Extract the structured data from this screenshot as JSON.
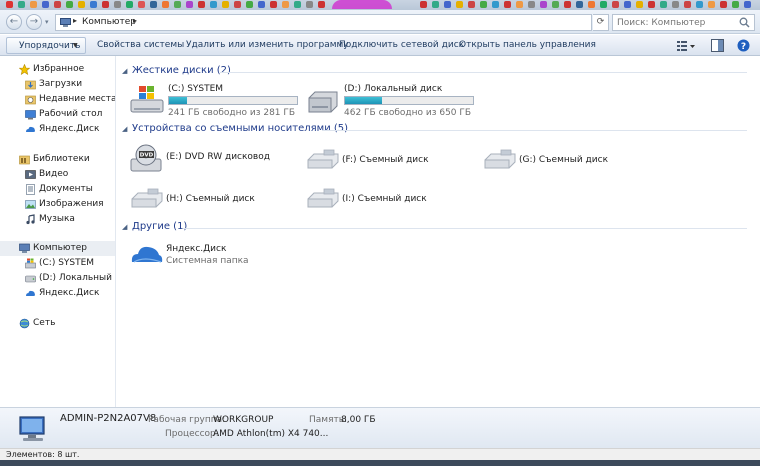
{
  "address_bar": {
    "back": "←",
    "forward": "→",
    "breadcrumb": "Компьютер",
    "refresh": "⟳",
    "search_placeholder": "Поиск: Компьютер"
  },
  "toolbar": {
    "organize": "Упорядочить",
    "system_props": "Свойства системы",
    "uninstall": "Удалить или изменить программу",
    "map_drive": "Подключить сетевой диск",
    "control_panel": "Открыть панель управления"
  },
  "nav": {
    "favorites": "Избранное",
    "downloads": "Загрузки",
    "recent": "Недавние места",
    "desktop": "Рабочий стол",
    "yadisk": "Яндекс.Диск",
    "libraries": "Библиотеки",
    "video": "Видео",
    "documents": "Документы",
    "pictures": "Изображения",
    "music": "Музыка",
    "computer": "Компьютер",
    "c_system": "(C:) SYSTEM",
    "d_local": "(D:) Локальный диск",
    "yadisk2": "Яндекс.Диск",
    "network": "Сеть"
  },
  "groups": {
    "hdd": "Жесткие диски (2)",
    "removable": "Устройства со съемными носителями (5)",
    "other": "Другие (1)"
  },
  "drives": {
    "c": {
      "name": "(C:) SYSTEM",
      "free": "241 ГБ свободно из 281 ГБ",
      "used_fraction": 0.14
    },
    "d": {
      "name": "(D:) Локальный диск",
      "free": "462 ГБ свободно из 650 ГБ",
      "used_fraction": 0.29
    }
  },
  "removable": {
    "e": "(E:) DVD RW дисковод",
    "f": "(F:) Съемный диск",
    "g": "(G:) Съемный диск",
    "h": "(H:) Съемный диск",
    "i": "(I:) Съемный диск"
  },
  "other": {
    "yadisk_name": "Яндекс.Диск",
    "yadisk_sub": "Системная папка"
  },
  "details": {
    "pc_name": "ADMIN-P2N2A07V8",
    "workgroup_key": "Рабочая группа:",
    "workgroup_val": "WORKGROUP",
    "memory_key": "Память:",
    "memory_val": "8,00 ГБ",
    "cpu_key": "Процессор:",
    "cpu_val": "AMD Athlon(tm) X4 740..."
  },
  "status": {
    "items": "Элементов: 8 шт."
  },
  "colors": {
    "accent": "#1e3a8a",
    "bar_fill": "#1d93b6",
    "selected": "#eaeef3"
  }
}
